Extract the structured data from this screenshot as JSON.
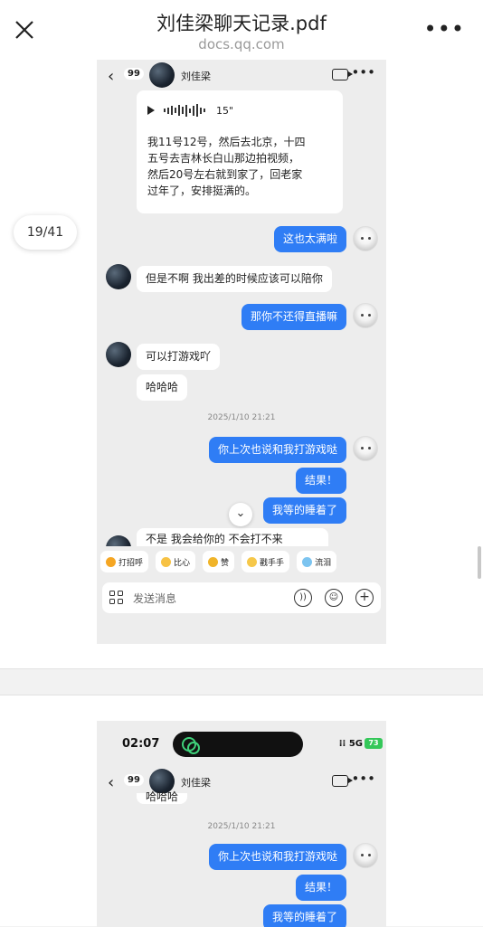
{
  "header": {
    "title": "刘佳梁聊天记录.pdf",
    "subtitle": "docs.qq.com",
    "close_icon": "close-icon",
    "more_icon": "more-dots-icon"
  },
  "viewer": {
    "page_indicator": "19/41"
  },
  "chat1": {
    "back_badge": "99",
    "contact_name": "刘佳梁",
    "voice_duration": "15\"",
    "voice_text": "我11号12号，然后去北京，十四\n五号去吉林长白山那边拍视频，\n然后20号左右就到家了，回老家\n过年了，安排挺满的。",
    "messages": [
      {
        "side": "out",
        "text": "这也太满啦"
      },
      {
        "side": "in",
        "text": "但是不啊 我出差的时候应该可以陪你"
      },
      {
        "side": "out",
        "text": "那你不还得直播嘛"
      },
      {
        "side": "in",
        "text": "可以打游戏吖"
      },
      {
        "side": "in",
        "text": "哈哈哈"
      },
      {
        "side": "out",
        "text": "你上次也说和我打游戏哒"
      },
      {
        "side": "out",
        "text": "结果！"
      },
      {
        "side": "out",
        "text": "我等的睡着了"
      }
    ],
    "timestamp": "2025/1/10 21:21",
    "partial_message": "不是 我会给你的 不会打不来",
    "quick_replies": [
      "打招呼",
      "比心",
      "赞",
      "戳手手",
      "流泪"
    ],
    "input_placeholder": "发送消息"
  },
  "chat2": {
    "status_time": "02:07",
    "signal": "5G",
    "battery": "73",
    "back_badge": "99",
    "contact_name": "刘佳梁",
    "partial_top": "哈哈哈",
    "timestamp": "2025/1/10 21:21",
    "messages": [
      {
        "side": "out",
        "text": "你上次也说和我打游戏哒"
      },
      {
        "side": "out",
        "text": "结果！"
      },
      {
        "side": "out",
        "text": "我等的睡着了"
      }
    ]
  }
}
